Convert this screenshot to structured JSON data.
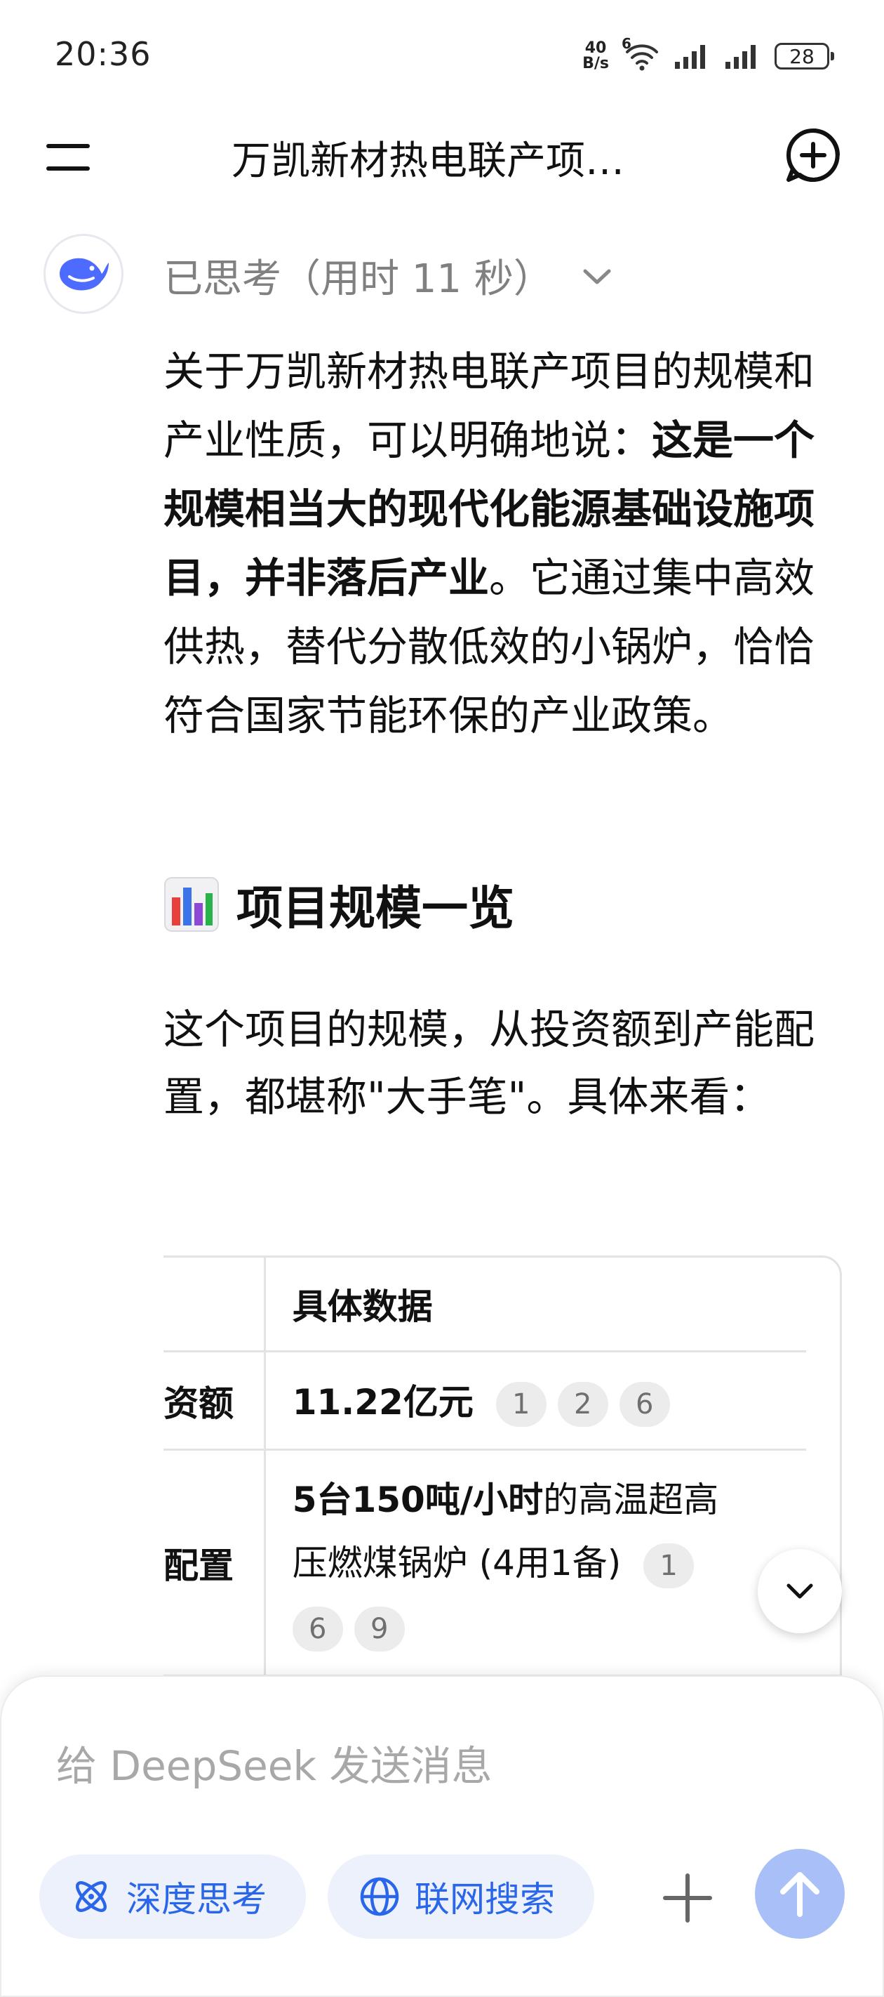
{
  "status_bar": {
    "time": "20:36",
    "net_speed_value": "40",
    "net_speed_unit": "B/s",
    "wifi_badge": "6",
    "battery": "28"
  },
  "header": {
    "title": "万凯新材热电联产项…"
  },
  "thinking": {
    "label": "已思考（用时 11 秒）"
  },
  "answer": {
    "p1_intro": "关于万凯新材热电联产项目的规模和产业性质，可以明确地说：",
    "p1_bold": "这是一个规模相当大的现代化能源基础设施项目，并非落后产业",
    "p1_rest": "。它通过集中高效供热，替代分散低效的小锅炉，恰恰符合国家节能环保的产业政策。",
    "section_title": "项目规模一览",
    "section_icon": "bar-chart-emoji",
    "p2": "这个项目的规模，从投资额到产能配置，都堪称\"大手笔\"。具体来看："
  },
  "table": {
    "header_col2": "具体数据",
    "rows": [
      {
        "label": "资额",
        "value_bold": "11.22亿元",
        "value_rest": "",
        "citations": [
          "1",
          "2",
          "6"
        ]
      },
      {
        "label": "配置",
        "value_bold": "5台150吨/小时",
        "value_rest": "的高温超高压燃煤锅炉 (4用1备)",
        "citations": [
          "1",
          "6",
          "9"
        ]
      }
    ]
  },
  "composer": {
    "placeholder": "给 DeepSeek 发送消息",
    "deep_think_label": "深度思考",
    "web_search_label": "联网搜索"
  },
  "colors": {
    "accent": "#2a66e9",
    "pill_bg": "#edf1fb",
    "send_button": "#a9bff7",
    "logo_blue": "#4d6bfe"
  }
}
